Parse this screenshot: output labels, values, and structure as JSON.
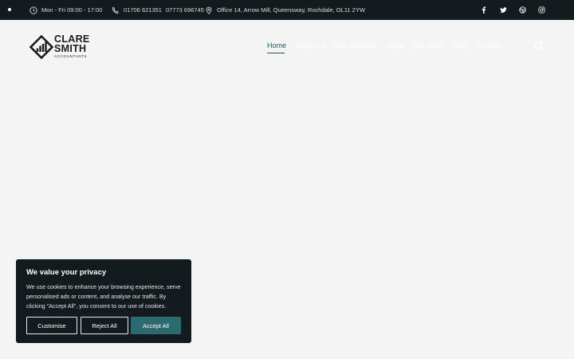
{
  "topbar": {
    "hours": "Mon - Fri 09:00 - 17:00",
    "phone_1": "01706 621351",
    "phone_2": "07773 696745",
    "address": "Office 14, Arrow Mill, Queensway, Rochdale, OL11 2YW",
    "social_icons": [
      "facebook-icon",
      "twitter-icon",
      "dribbble-icon",
      "instagram-icon"
    ]
  },
  "logo": {
    "line1": "CLARE",
    "line2": "SMITH",
    "tagline": "ACCOUNTANTS"
  },
  "nav": {
    "items": [
      "Home",
      "About Us",
      "Our Services",
      "FAQs",
      "Our Team",
      "Blog",
      "Contact"
    ],
    "active": "Home"
  },
  "cookie_banner": {
    "title": "We value your privacy",
    "text": "We use cookies to enhance your browsing experience, serve personalised ads or content, and analyse our traffic. By clicking \"Accept All\", you consent to our use of cookies.",
    "customise_label": "Customise",
    "reject_label": "Reject All",
    "accept_label": "Accept All"
  },
  "colors": {
    "topbar_bg": "#141b1e",
    "page_bg": "#f4f4f4",
    "accent": "#2b6a6e",
    "nav_active": "#1f5a60"
  }
}
